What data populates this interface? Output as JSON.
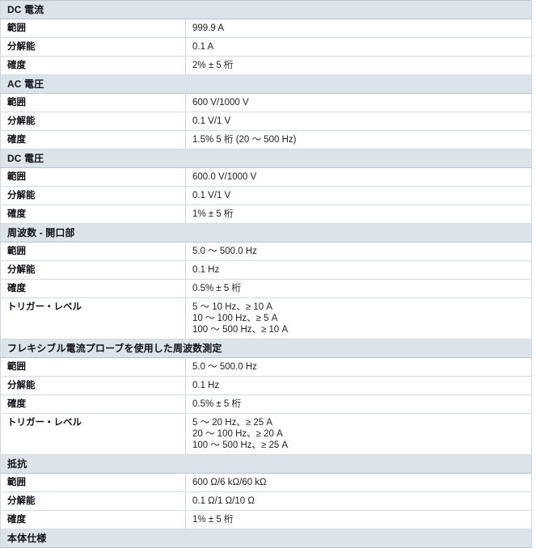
{
  "table": {
    "row_label_range": "範囲",
    "row_label_resolution": "分解能",
    "row_label_accuracy": "確度",
    "row_label_trigger_level": "トリガー・レベル",
    "sections": [
      {
        "title": "DC 電流",
        "rows": [
          {
            "label": "範囲",
            "value": "999.9 A"
          },
          {
            "label": "分解能",
            "value": "0.1 A"
          },
          {
            "label": "確度",
            "value": "2% ± 5 桁"
          }
        ]
      },
      {
        "title": "AC 電圧",
        "rows": [
          {
            "label": "範囲",
            "value": "600 V/1000 V"
          },
          {
            "label": "分解能",
            "value": "0.1 V/1 V"
          },
          {
            "label": "確度",
            "value": "1.5% 5 桁 (20 ～ 500 Hz)"
          }
        ]
      },
      {
        "title": "DC 電圧",
        "rows": [
          {
            "label": "範囲",
            "value": "600.0 V/1000 V"
          },
          {
            "label": "分解能",
            "value": "0.1 V/1 V"
          },
          {
            "label": "確度",
            "value": "1% ± 5 桁"
          }
        ]
      },
      {
        "title": "周波数 - 開口部",
        "rows": [
          {
            "label": "範囲",
            "value": "5.0 ～ 500.0 Hz"
          },
          {
            "label": "分解能",
            "value": "0.1 Hz"
          },
          {
            "label": "確度",
            "value": "0.5% ± 5 桁"
          },
          {
            "label": "トリガー・レベル",
            "value": "5 ～ 10 Hz、≥ 10 A\n10 ～ 100 Hz、≥ 5 A\n100 ～ 500 Hz、≥ 10 A"
          }
        ]
      },
      {
        "title": "フレキシブル電流プローブを使用した周波数測定",
        "rows": [
          {
            "label": "範囲",
            "value": "5.0 ～ 500.0 Hz"
          },
          {
            "label": "分解能",
            "value": "0.1 Hz"
          },
          {
            "label": "確度",
            "value": "0.5% ± 5 桁"
          },
          {
            "label": "トリガー・レベル",
            "value": "5 ～ 20 Hz、≥ 25 A\n20 ～ 100 Hz、≥ 20 A\n100 ～ 500 Hz、≥ 25 A"
          }
        ]
      },
      {
        "title": "抵抗",
        "rows": [
          {
            "label": "範囲",
            "value": "600 Ω/6 kΩ/60 kΩ"
          },
          {
            "label": "分解能",
            "value": "0.1 Ω/1 Ω/10 Ω"
          },
          {
            "label": "確度",
            "value": "1% ± 5 桁"
          }
        ]
      },
      {
        "title": "本体仕様",
        "rows": []
      }
    ]
  },
  "colors": {
    "section_header_bg": "#dce3ea",
    "section_header_border": "#b9c4d0",
    "row_border": "#d3dae2",
    "text": "#1a1a1a",
    "page_bg": "#ffffff"
  }
}
